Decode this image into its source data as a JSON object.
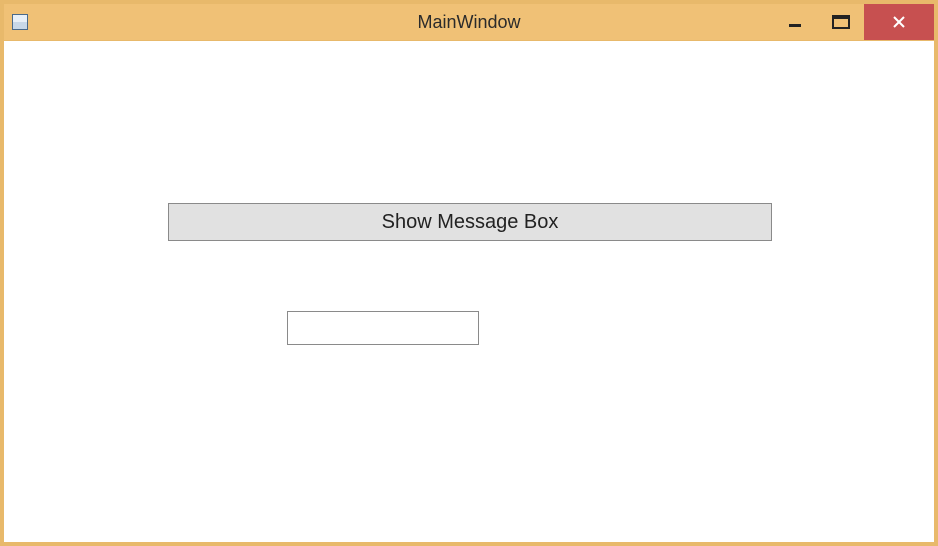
{
  "window": {
    "title": "MainWindow"
  },
  "controls": {
    "showMessageBoxLabel": "Show Message Box",
    "textboxValue": ""
  }
}
